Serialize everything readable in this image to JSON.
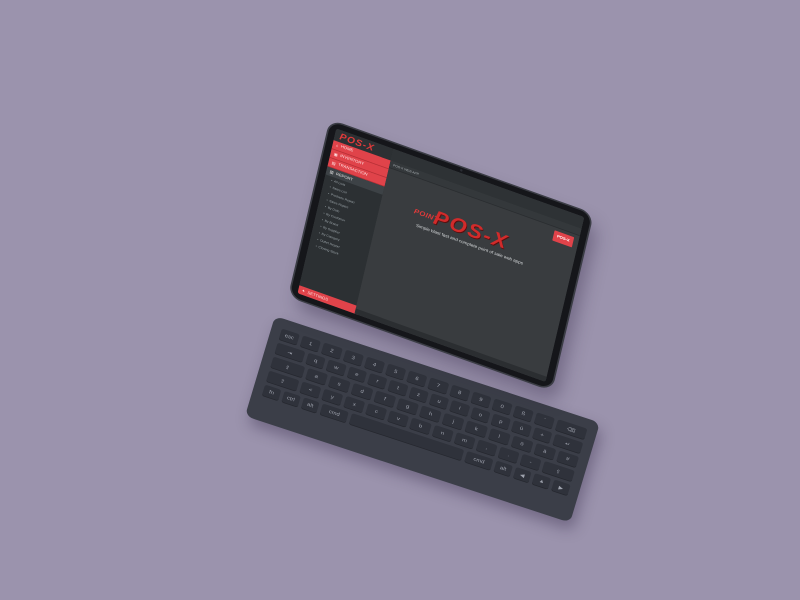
{
  "app": {
    "logo": "POS-X",
    "logo_prefix": "POINT",
    "tagline": "Simple blast fast and complete point of sale web apps"
  },
  "sidebar": {
    "items": [
      {
        "label": "HOME",
        "icon": "home-icon"
      },
      {
        "label": "INVENTORY",
        "icon": "box-icon"
      },
      {
        "label": "TRANSACTION",
        "icon": "cart-icon"
      }
    ],
    "report": {
      "label": "REPORT",
      "icon": "chart-icon"
    },
    "report_items": [
      {
        "label": "All Lists",
        "icon": "list-icon"
      },
      {
        "label": "Sales List",
        "icon": "list-icon"
      },
      {
        "label": "Products Report",
        "icon": "list-icon"
      },
      {
        "label": "Sales Report",
        "icon": "list-icon"
      },
      {
        "label": "By Date",
        "icon": "list-icon"
      },
      {
        "label": "By Customer",
        "icon": "list-icon"
      },
      {
        "label": "By Brand",
        "icon": "list-icon"
      },
      {
        "label": "By Supplier",
        "icon": "list-icon"
      },
      {
        "label": "By Category",
        "icon": "list-icon"
      },
      {
        "label": "Outlet Report",
        "icon": "list-icon"
      },
      {
        "label": "Closing Stock",
        "icon": "list-icon"
      }
    ],
    "bottom": {
      "label": "SETTINGS",
      "icon": "gear-icon"
    }
  },
  "main": {
    "breadcrumb": "POS-X WEB APP",
    "toolbar_button": "POS-X"
  },
  "colors": {
    "accent": "#e0434a",
    "sidebar_bg": "#2c3033",
    "screen_bg": "#393c3f",
    "backdrop": "#9b93ad"
  },
  "keyboard": {
    "rows": [
      [
        "esc",
        "1",
        "2",
        "3",
        "4",
        "5",
        "6",
        "7",
        "8",
        "9",
        "0",
        "ß",
        "´",
        "⌫"
      ],
      [
        "⇥",
        "q",
        "w",
        "e",
        "r",
        "t",
        "z",
        "u",
        "i",
        "o",
        "p",
        "ü",
        "+",
        "↵"
      ],
      [
        "⇪",
        "a",
        "s",
        "d",
        "f",
        "g",
        "h",
        "j",
        "k",
        "l",
        "ö",
        "ä",
        "#"
      ],
      [
        "⇧",
        "<",
        "y",
        "x",
        "c",
        "v",
        "b",
        "n",
        "m",
        ",",
        ".",
        "-",
        "⇧"
      ],
      [
        "fn",
        "ctrl",
        "alt",
        "cmd",
        "",
        "cmd",
        "alt",
        "◀",
        "▲",
        "▶"
      ]
    ]
  }
}
